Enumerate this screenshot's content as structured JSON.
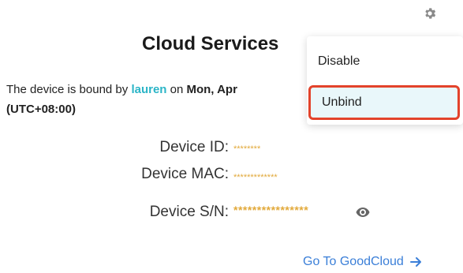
{
  "header": {
    "title": "Cloud Services"
  },
  "binding": {
    "prefix": "The device is bound by ",
    "user": "lauren",
    "mid": " on ",
    "date": "Mon, Apr",
    "timezone": "(UTC+08:00)"
  },
  "device": {
    "id_label": "Device ID:",
    "id_value": "********",
    "mac_label": "Device MAC:",
    "mac_value": "*************",
    "sn_label": "Device S/N:",
    "sn_value": "****************"
  },
  "footer": {
    "goto_label": "Go To GoodCloud",
    "goto_icon": "arrow-right-icon"
  },
  "menu": {
    "items": [
      {
        "label": "Disable"
      },
      {
        "label": "Unbind"
      }
    ]
  },
  "colors": {
    "accent": "#3b7fd8",
    "user": "#2bb5c7",
    "masked": "#e2a93a",
    "highlight_border": "#e3432b",
    "highlight_bg": "#e9f7fa"
  }
}
